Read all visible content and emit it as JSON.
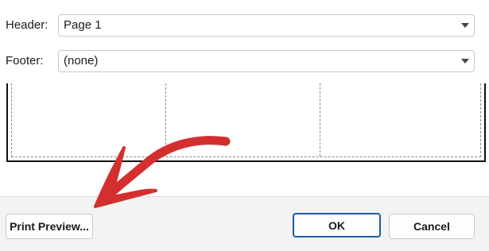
{
  "header": {
    "label": "Header:",
    "value": "Page 1"
  },
  "footer": {
    "label": "Footer:",
    "value": "(none)"
  },
  "buttons": {
    "print_preview": "Print Preview...",
    "ok": "OK",
    "cancel": "Cancel"
  },
  "colors": {
    "accent_border": "#1f5aa6",
    "annotation_arrow": "#d32f2f"
  },
  "icons": [
    "chevron-down-icon",
    "annotation-arrow"
  ]
}
